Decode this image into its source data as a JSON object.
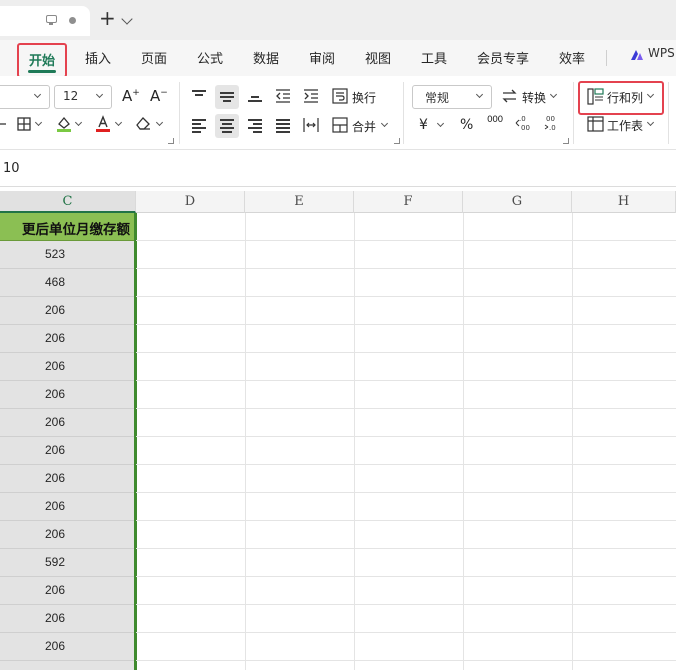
{
  "tabbar": {
    "new_tab_symbol": "+"
  },
  "menu": {
    "items": [
      "开始",
      "插入",
      "页面",
      "公式",
      "数据",
      "审阅",
      "视图",
      "工具",
      "会员专享",
      "效率"
    ],
    "active": "开始",
    "wps_label": "WPS"
  },
  "ribbon": {
    "font_size": "12",
    "wrap_label": "换行",
    "merge_label": "合并",
    "number_format": "常规",
    "convert_label": "转换",
    "currency_symbol": "¥",
    "percent_symbol": "%",
    "thousands_symbol": "000",
    "row_col_label": "行和列",
    "worksheet_label": "工作表",
    "accent_color": "#1f7a58",
    "highlight_box_color": "#e4424f"
  },
  "formula_bar": {
    "value": "10"
  },
  "sheet": {
    "columns": [
      "C",
      "D",
      "E",
      "F",
      "G",
      "H"
    ],
    "selected_column": "C",
    "header_cell": "更后单位月缴存额",
    "values": [
      "523",
      "468",
      "206",
      "206",
      "206",
      "206",
      "206",
      "206",
      "206",
      "206",
      "206",
      "592",
      "206",
      "206",
      "206"
    ],
    "header_fill": "#8bbf53",
    "selection_color": "#3f8a2e"
  }
}
